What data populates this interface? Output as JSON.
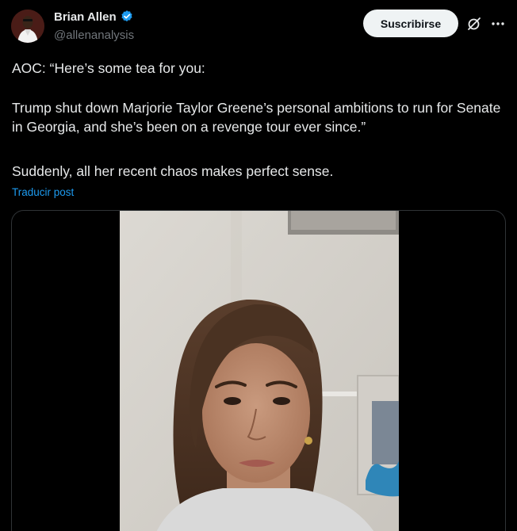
{
  "author": {
    "name": "Brian Allen",
    "handle": "@allenanalysis",
    "verified": true,
    "verified_color": "#1d9bf0"
  },
  "actions": {
    "subscribe_label": "Suscribirse",
    "grok_icon": "grok-icon",
    "more_icon": "more-icon"
  },
  "post": {
    "paragraphs": [
      "AOC: “Here’s some tea for you:",
      "Trump shut down Marjorie Taylor Greene’s personal ambitions to run for Senate in Georgia, and she’s been on a revenge tour ever since.”",
      "Suddenly, all her recent chaos makes perfect sense."
    ],
    "translate_label": "Traducir post"
  },
  "media": {
    "type": "video",
    "subject": "video-frame"
  },
  "colors": {
    "background": "#000000",
    "text": "#e7e9ea",
    "muted": "#71767b",
    "link": "#1d9bf0",
    "button_bg": "#eff3f4"
  }
}
